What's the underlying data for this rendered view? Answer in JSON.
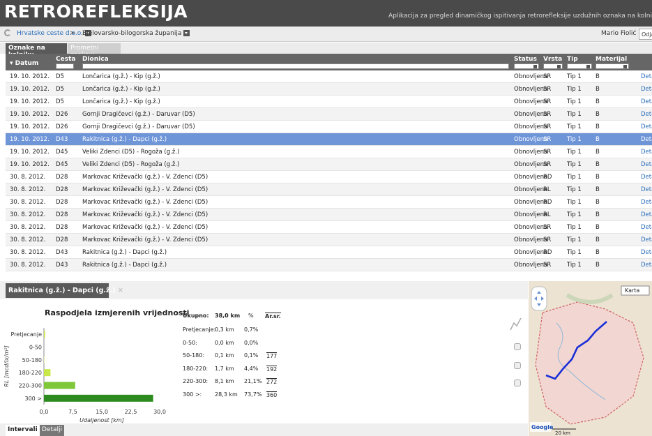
{
  "app": {
    "logo": "RETROREFLEKSIJA",
    "tagline": "Aplikacija za pregled dinamičkog ispitivanja retrorefleksije uzdužnih oznaka na kolni"
  },
  "breadcrumb": {
    "company": "Hrvatske ceste d.o.o.",
    "separator": ">",
    "county": "Bjelovarsko-bilogorska županija",
    "user": "Mario Fiolić",
    "user_action": "Odja"
  },
  "tabs": [
    "Oznake na kolniku",
    "Prometni znakovi"
  ],
  "grid": {
    "columns": {
      "datum": "Datum",
      "cesta": "Cesta",
      "dionica": "Dionica",
      "status": "Status",
      "vrsta": "Vrsta",
      "tip": "Tip",
      "materijal": "Materijal"
    },
    "detail_label": "Detal",
    "rows": [
      [
        "19. 10. 2012.",
        "D5",
        "Lončarica (g.ž.) - Kip (g.ž.)",
        "Obnovljena",
        "SR",
        "Tip 1",
        "B"
      ],
      [
        "19. 10. 2012.",
        "D5",
        "Lončarica (g.ž.) - Kip (g.ž.)",
        "Obnovljena",
        "SR",
        "Tip 1",
        "B"
      ],
      [
        "19. 10. 2012.",
        "D5",
        "Lončarica (g.ž.) - Kip (g.ž.)",
        "Obnovljena",
        "SR",
        "Tip 1",
        "B"
      ],
      [
        "19. 10. 2012.",
        "D26",
        "Gornji Dragičevci (g.ž.) - Daruvar (D5)",
        "Obnovljena",
        "SR",
        "Tip 1",
        "B"
      ],
      [
        "19. 10. 2012.",
        "D26",
        "Gornji Dragičevci (g.ž.) - Daruvar (D5)",
        "Obnovljena",
        "SR",
        "Tip 1",
        "B"
      ],
      [
        "19. 10. 2012.",
        "D43",
        "Rakitnica (g.ž.) - Dapci (g.ž.)",
        "Obnovljena",
        "SR",
        "Tip 1",
        "B"
      ],
      [
        "19. 10. 2012.",
        "D45",
        "Veliki Zdenci (D5) - Rogoža (g.ž.)",
        "Obnovljena",
        "SR",
        "Tip 1",
        "B"
      ],
      [
        "19. 10. 2012.",
        "D45",
        "Veliki Zdenci (D5) - Rogoža (g.ž.)",
        "Obnovljena",
        "SR",
        "Tip 1",
        "B"
      ],
      [
        "30. 8. 2012.",
        "D28",
        "Markovac Križevački (g.ž.) - V. Zdenci (D5)",
        "Obnovljena",
        "RD",
        "Tip 1",
        "B"
      ],
      [
        "30. 8. 2012.",
        "D28",
        "Markovac Križevački (g.ž.) - V. Zdenci (D5)",
        "Obnovljena",
        "RL",
        "Tip 1",
        "B"
      ],
      [
        "30. 8. 2012.",
        "D28",
        "Markovac Križevački (g.ž.) - V. Zdenci (D5)",
        "Obnovljena",
        "RD",
        "Tip 1",
        "B"
      ],
      [
        "30. 8. 2012.",
        "D28",
        "Markovac Križevački (g.ž.) - V. Zdenci (D5)",
        "Obnovljena",
        "RL",
        "Tip 1",
        "B"
      ],
      [
        "30. 8. 2012.",
        "D28",
        "Markovac Križevački (g.ž.) - V. Zdenci (D5)",
        "Obnovljena",
        "SR",
        "Tip 1",
        "B"
      ],
      [
        "30. 8. 2012.",
        "D28",
        "Markovac Križevački (g.ž.) - V. Zdenci (D5)",
        "Obnovljena",
        "SR",
        "Tip 1",
        "B"
      ],
      [
        "30. 8. 2012.",
        "D43",
        "Rakitnica (g.ž.) - Dapci (g.ž.)",
        "Obnovljena",
        "RD",
        "Tip 1",
        "B"
      ],
      [
        "30. 8. 2012.",
        "D43",
        "Rakitnica (g.ž.) - Dapci (g.ž.)",
        "Obnovljena",
        "SR",
        "Tip 1",
        "B"
      ]
    ],
    "selected_index": 5
  },
  "detail_panel": {
    "title": "Rakitnica (g.ž.) - Dapci (g.ž.)",
    "stats_header": {
      "label": "Ukupno:",
      "km": "38,0 km",
      "pct": "%",
      "avg": "Ar.sr."
    },
    "stats": [
      {
        "label": "Pretjecanje:",
        "km": "0,3 km",
        "pct": "0,7%",
        "avg": ""
      },
      {
        "label": "0-50:",
        "km": "0,0 km",
        "pct": "0,0%",
        "avg": ""
      },
      {
        "label": "50-180:",
        "km": "0,1 km",
        "pct": "0,1%",
        "avg": "177"
      },
      {
        "label": "180-220:",
        "km": "1,7 km",
        "pct": "4,4%",
        "avg": "192"
      },
      {
        "label": "220-300:",
        "km": "8,1 km",
        "pct": "21,1%",
        "avg": "272"
      },
      {
        "label": "300 >:",
        "km": "28,3 km",
        "pct": "73,7%",
        "avg": "360"
      }
    ],
    "bottom_tabs": [
      "Intervali",
      "Detalji"
    ]
  },
  "map": {
    "button": "Karta",
    "scale_label": "20 km"
  },
  "colors": {
    "header": "#4a4a4a",
    "grid_header": "#666666",
    "selected_row": "#6f95d9",
    "bar_dark": "#2d8a1e",
    "bar_mid": "#7ec83a",
    "bar_light": "#c8e84a"
  },
  "chart_data": {
    "type": "bar",
    "orientation": "horizontal",
    "title": "Raspodjela izmjerenih vrijednosti",
    "xlabel": "Udaljenost [km]",
    "ylabel": "RL [mcd/lx/m²]",
    "categories": [
      "Pretjecanje",
      "0-50",
      "50-180",
      "180-220",
      "220-300",
      "300 >"
    ],
    "values": [
      0.3,
      0.0,
      0.1,
      1.7,
      8.1,
      28.3
    ],
    "xlim": [
      0,
      30
    ],
    "xticks": [
      "0,0",
      "7,5",
      "15,0",
      "22,5",
      "30,0"
    ],
    "bar_colors": [
      "#c8e84a",
      "#c8e84a",
      "#c8e84a",
      "#c8e84a",
      "#7ec83a",
      "#2d8a1e"
    ]
  }
}
